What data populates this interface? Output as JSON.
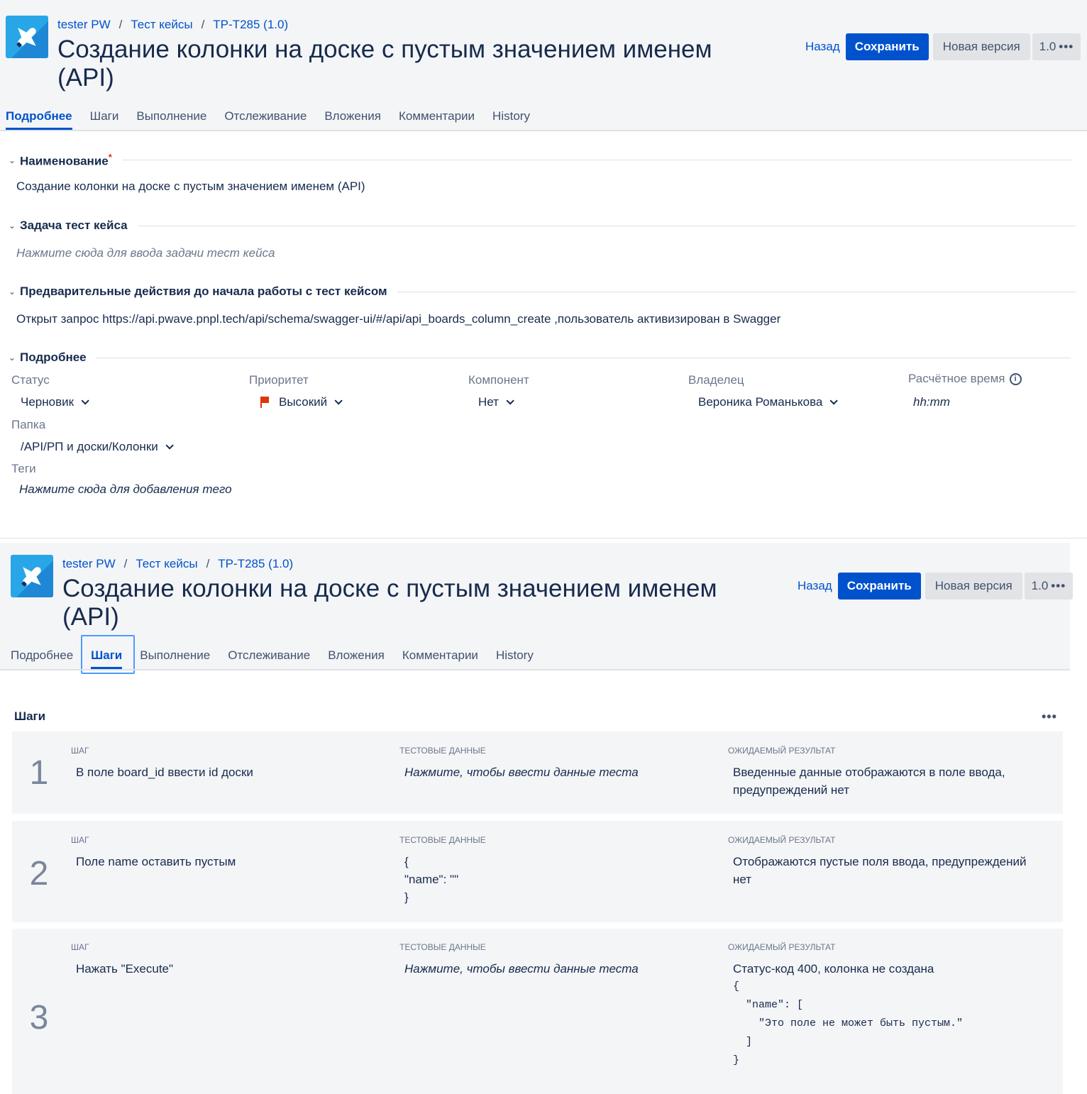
{
  "header": {
    "breadcrumb": [
      "tester PW",
      "Тест кейсы",
      "TP-T285 (1.0)"
    ],
    "title": "Создание колонки на доске с пустым значением именем (API)",
    "back_label": "Назад",
    "save_label": "Сохранить",
    "new_version_label": "Новая версия",
    "version_label": "1.0",
    "more_label": "•••"
  },
  "tabs": [
    "Подробнее",
    "Шаги",
    "Выполнение",
    "Отслеживание",
    "Вложения",
    "Комментарии",
    "History"
  ],
  "details": {
    "name_section": "Наименование",
    "required_mark": "*",
    "name_value": "Создание колонки на доске с пустым значением именем (API)",
    "task_section": "Задача тест кейса",
    "task_placeholder": "Нажмите сюда для ввода задачи тест кейса",
    "precond_section": "Предварительные действия до начала работы с тест кейсом",
    "precond_value": "Открыт запрос https://api.pwave.pnpl.tech/api/schema/swagger-ui/#/api/api_boards_column_create  ,пользователь активизирован в Swagger",
    "details_section": "Подробнее",
    "status_label": "Статус",
    "status_value": "Черновик",
    "priority_label": "Приоритет",
    "priority_value": "Высокий",
    "priority_color": "#de350b",
    "component_label": "Компонент",
    "component_value": "Нет",
    "owner_label": "Владелец",
    "owner_value": "Вероника Романькова",
    "estimate_label": "Расчётное время",
    "estimate_placeholder": "hh:mm",
    "folder_label": "Папка",
    "folder_value": "/API/РП и доски/Колонки",
    "tags_label": "Теги",
    "tags_placeholder": "Нажмите сюда для добавления тего"
  },
  "steps": {
    "title": "Шаги",
    "more_label": "•••",
    "col_step": "Шаг",
    "col_data": "Тестовые данные",
    "col_result": "Ожидаемый результат",
    "items": [
      {
        "num": "1",
        "step": "В поле board_id  ввести id доски",
        "data": "Нажмите, чтобы ввести данные теста",
        "result": "Введенные данные отображаются в поле ввода, предупреждений нет"
      },
      {
        "num": "2",
        "step": "Поле name оставить пустым",
        "data_lines": [
          "{",
          "\"name\": \"\"",
          "}"
        ],
        "result": "Отображаются пустые поля ввода, предупреждений нет"
      },
      {
        "num": "3",
        "step": "Нажать \"Execute\"",
        "data": "Нажмите, чтобы ввести данные теста",
        "result": "Статус-код 400, колонка не создана",
        "result_code": "{\n  \"name\": [\n    \"Это поле не может быть пустым.\"\n  ]\n}"
      }
    ]
  },
  "colors": {
    "accent": "#0052cc",
    "header_bg": "#f4f5f7",
    "card_bg": "#f4f5f7"
  }
}
